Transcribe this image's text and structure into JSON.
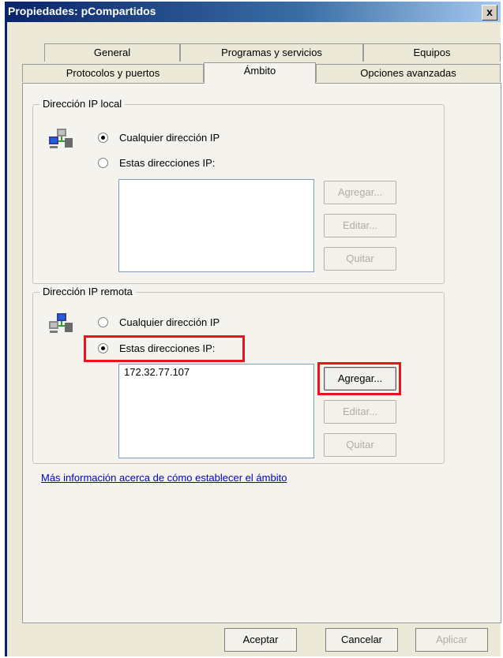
{
  "window": {
    "title": "Propiedades: pCompartidos",
    "close_glyph": "x"
  },
  "tabs_row1": [
    "General",
    "Programas y servicios",
    "Equipos"
  ],
  "tabs_row2": [
    "Protocolos y puertos",
    "Ámbito",
    "Opciones avanzadas"
  ],
  "local_group": {
    "legend": "Dirección IP local",
    "radio_any": "Cualquier dirección IP",
    "radio_these": "Estas direcciones IP:",
    "selected": "any",
    "list_items": [],
    "buttons": {
      "add": "Agregar...",
      "edit": "Editar...",
      "remove": "Quitar"
    }
  },
  "remote_group": {
    "legend": "Dirección IP remota",
    "radio_any": "Cualquier dirección IP",
    "radio_these": "Estas direcciones IP:",
    "selected": "these",
    "list_items": [
      "172.32.77.107"
    ],
    "buttons": {
      "add": "Agregar...",
      "edit": "Editar...",
      "remove": "Quitar"
    }
  },
  "link_text": "Más información acerca de cómo establecer el ámbito",
  "footer": {
    "ok": "Aceptar",
    "cancel": "Cancelar",
    "apply": "Aplicar"
  },
  "icons": {
    "local": "network-computers-icon",
    "remote": "network-computers-icon",
    "close": "close-icon"
  },
  "colors": {
    "highlight": "#e8141c",
    "titlebar": "#0a246a",
    "link": "#0000cc"
  }
}
